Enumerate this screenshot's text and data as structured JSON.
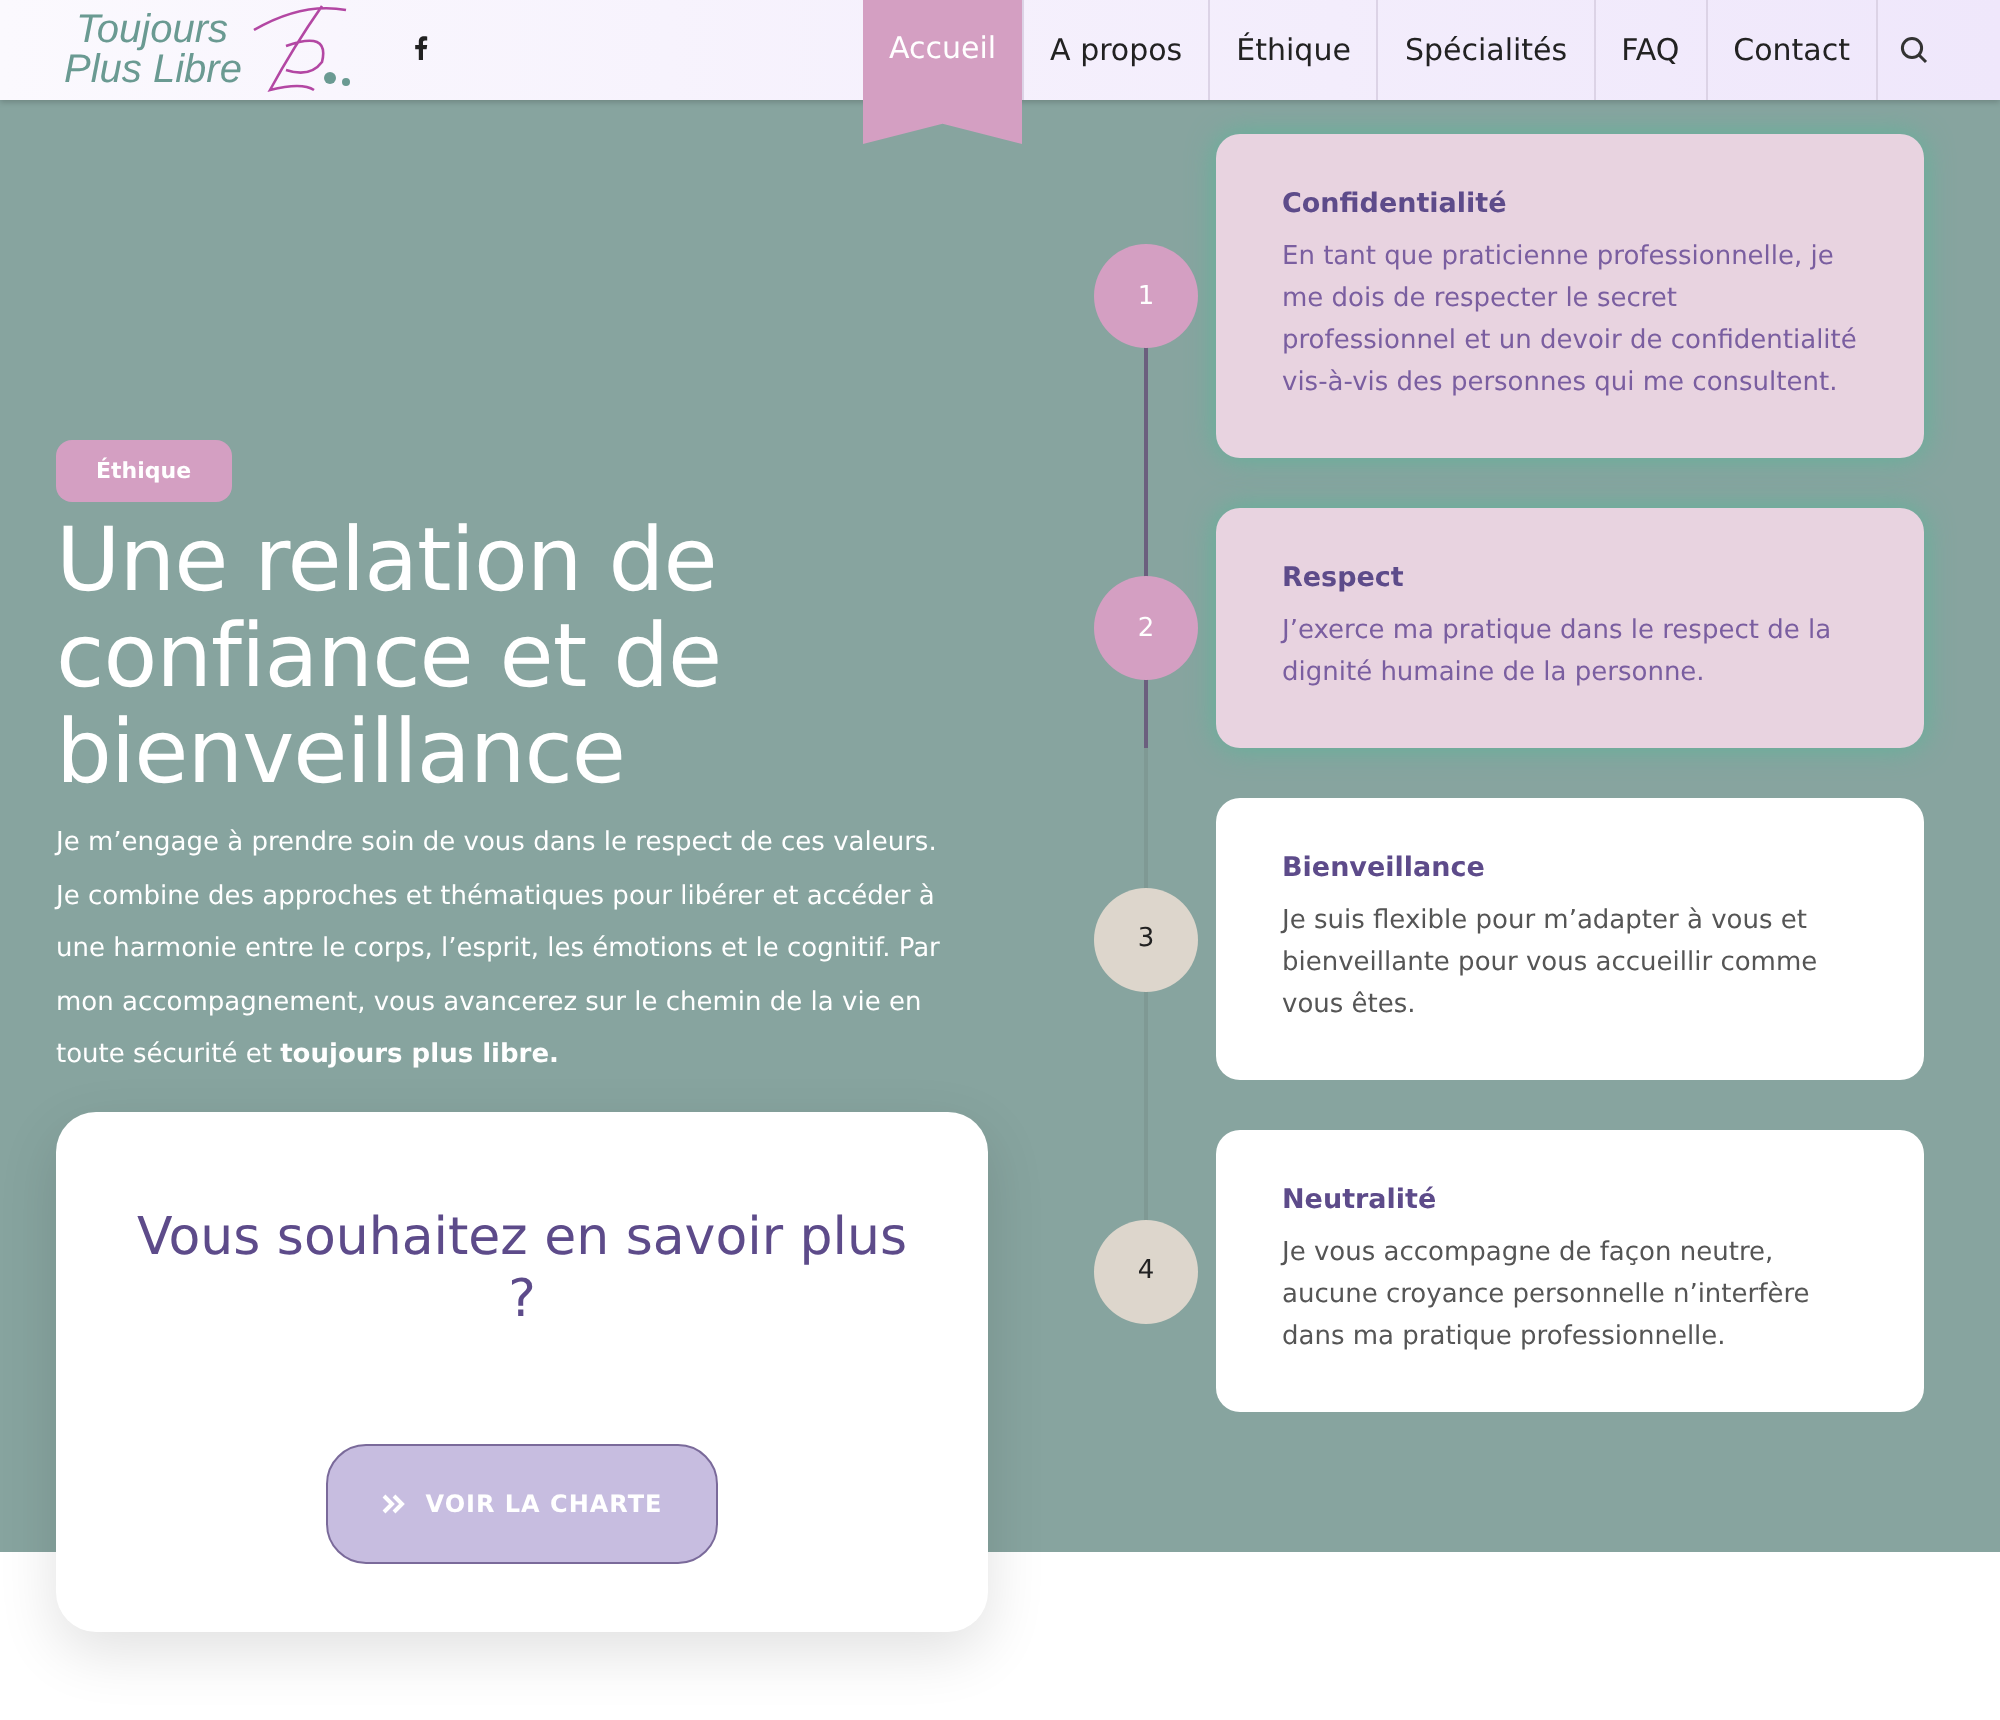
{
  "header": {
    "logo": {
      "line_1": "Toujours",
      "line_2": "Plus Libre"
    },
    "nav": [
      {
        "label": "Accueil",
        "selected": true
      },
      {
        "label": "A propos",
        "selected": false
      },
      {
        "label": "Éthique",
        "selected": false
      },
      {
        "label": "Spécialités",
        "selected": false
      },
      {
        "label": "FAQ",
        "selected": false
      },
      {
        "label": "Contact",
        "selected": false
      }
    ]
  },
  "hero": {
    "badge": "Éthique",
    "title": "Une relation de confiance et de bienveillance",
    "paragraphs": [
      "Je m’engage à prendre soin de vous dans le respect de ces valeurs.",
      "Je combine des approches et thématiques pour libérer et accéder à une harmonie entre le corps, l’esprit, les émotions et le cognitif. Par mon accompagnement, vous avancerez sur le chemin de la vie en toute sécurité et **toujours plus libre.**"
    ],
    "cta": {
      "title": "Vous souhaitez en savoir plus ?",
      "button": "VOIR LA CHARTE"
    }
  },
  "timeline": [
    {
      "number": "1",
      "title": "Confidentialité",
      "text": "En tant que praticienne professionnelle, je me dois de respecter le secret professionnel et un devoir de confidentialité vis-à-vis des personnes qui me consultent.",
      "highlighted": true
    },
    {
      "number": "2",
      "title": "Respect",
      "text": "J’exerce ma pratique dans le respect de la dignité humaine de la personne.",
      "highlighted": true
    },
    {
      "number": "3",
      "title": "Bienveillance",
      "text": "Je suis flexible pour m’adapter à vous et bienveillante pour vous accueillir comme vous êtes.",
      "highlighted": false
    },
    {
      "number": "4",
      "title": "Neutralité",
      "text": "Je vous accompagne de façon neutre, aucune croyance personnelle n’interfère dans ma pratique professionnelle.",
      "highlighted": false
    }
  ]
}
